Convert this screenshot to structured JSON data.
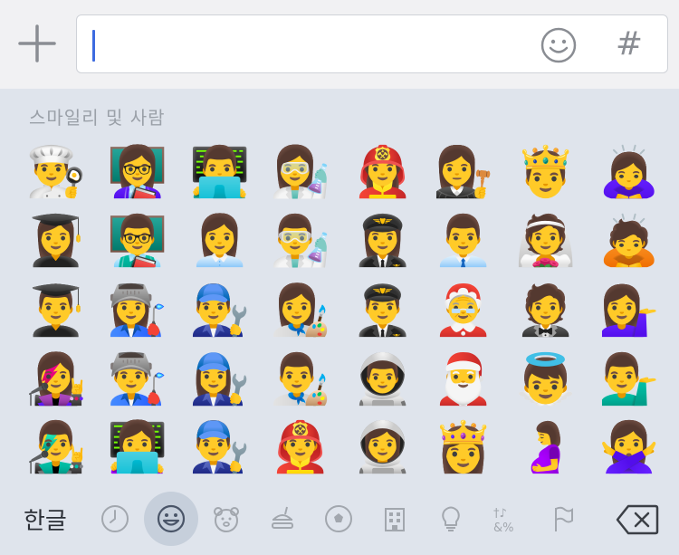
{
  "input": {
    "value": "",
    "plus_icon": "plus-icon",
    "emoji_icon": "smiley-face-icon",
    "hash_label": "#"
  },
  "emoji_panel": {
    "category_title": "스마일리 및 사람",
    "rows": [
      [
        "👨‍🍳",
        "👩‍🏫",
        "👨‍💻",
        "👩‍🔬",
        "👩‍🚒",
        "👩‍⚖️",
        "🤴",
        "🙇‍♀️"
      ],
      [
        "👩‍🎓",
        "👨‍🏫",
        "👩‍💼",
        "👨‍🔬",
        "👩‍✈️",
        "👨‍💼",
        "👰",
        "🙇"
      ],
      [
        "👨‍🎓",
        "👩‍🏭",
        "👨‍🔧",
        "👩‍🎨",
        "👨‍✈️",
        "🤶",
        "🤵",
        "💁‍♀️"
      ],
      [
        "👩‍🎤",
        "👨‍🏭",
        "👩‍🔧",
        "👨‍🎨",
        "👨‍🚀",
        "🎅",
        "👼",
        "💁‍♂️"
      ],
      [
        "👨‍🎤",
        "👩‍💻",
        "👨‍🔧",
        "👨‍🚒",
        "👩‍🚀",
        "👸",
        "🤰",
        "🙅‍♀️"
      ]
    ]
  },
  "bottom_bar": {
    "language_label": "한글",
    "categories": [
      {
        "name": "recent",
        "icon": "clock-icon"
      },
      {
        "name": "smileys",
        "icon": "smiley-icon",
        "active": true
      },
      {
        "name": "animals",
        "icon": "bear-icon"
      },
      {
        "name": "food",
        "icon": "food-icon"
      },
      {
        "name": "activity",
        "icon": "soccer-ball-icon"
      },
      {
        "name": "travel",
        "icon": "building-icon"
      },
      {
        "name": "objects",
        "icon": "lightbulb-icon"
      },
      {
        "name": "symbols",
        "icon": "symbols-icon"
      },
      {
        "name": "flags",
        "icon": "flag-icon"
      }
    ],
    "delete_icon": "backspace-icon"
  },
  "colors": {
    "keyboard_bg": "#dfe4ec",
    "topbar_bg": "#f1f1f3",
    "caret": "#3d6be0",
    "icon_gray": "#8a8d93",
    "active_category_bg": "#c6cfdb"
  }
}
